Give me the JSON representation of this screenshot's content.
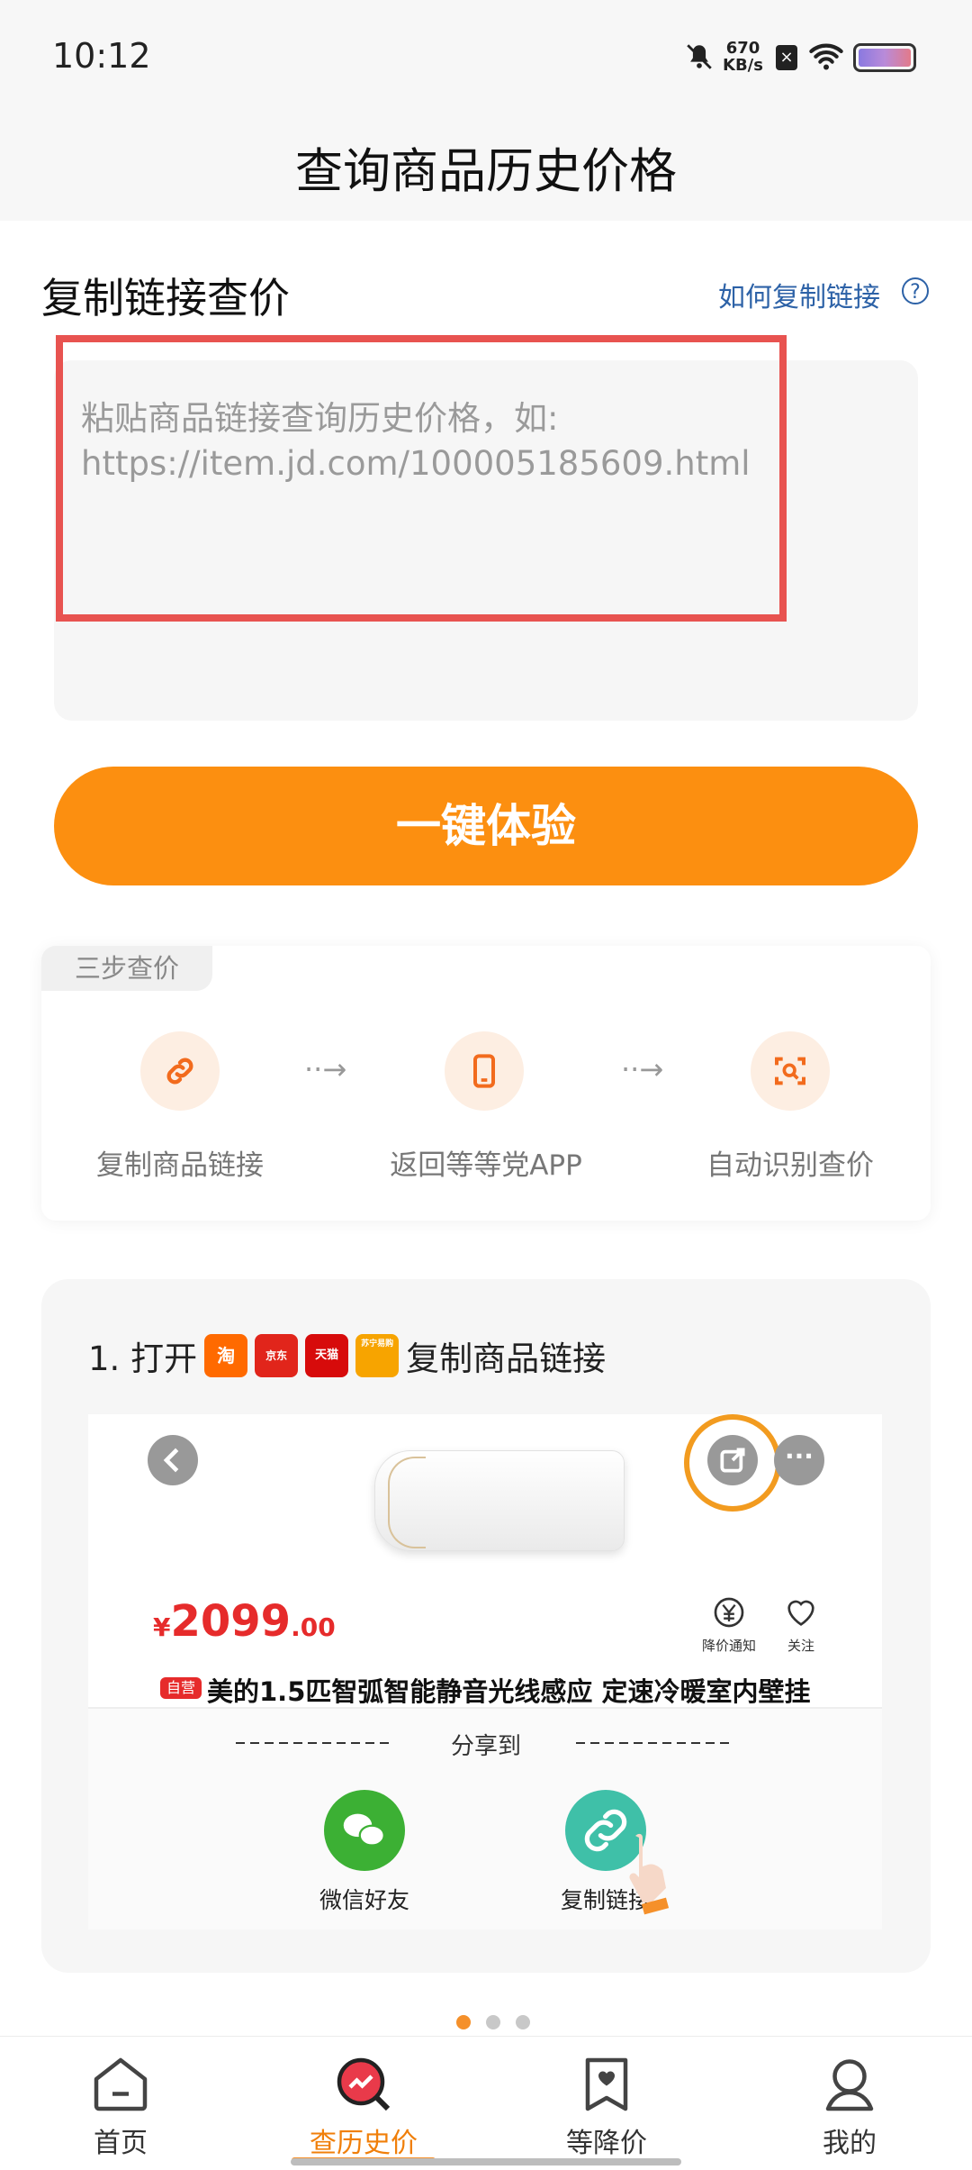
{
  "status_bar": {
    "time": "10:12",
    "net_speed_value": "670",
    "net_speed_unit": "KB/s"
  },
  "header": {
    "title": "查询商品历史价格"
  },
  "copy_section": {
    "title": "复制链接查价",
    "help_link": "如何复制链接",
    "help_icon": "?",
    "input_placeholder": "粘贴商品链接查询历史价格，如:\nhttps://item.jd.com/100005185609.html"
  },
  "primary_button": {
    "label": "一键体验"
  },
  "steps": {
    "tag": "三步查价",
    "items": [
      {
        "label": "复制商品链接",
        "icon": "link-icon"
      },
      {
        "label": "返回等等党APP",
        "icon": "phone-icon"
      },
      {
        "label": "自动识别查价",
        "icon": "scan-icon"
      }
    ],
    "arrow": "··→"
  },
  "tutorial": {
    "step_prefix": "1. 打开",
    "step_suffix": "复制商品链接",
    "app_logos": [
      {
        "name": "淘",
        "color": "#ff6a00"
      },
      {
        "name": "京东",
        "color": "#e1251b"
      },
      {
        "name": "天猫",
        "color": "#d70b0b"
      },
      {
        "name": "苏宁易购",
        "color": "#f7a400"
      }
    ],
    "preview": {
      "price_symbol": "¥",
      "price_main": "2099",
      "price_decimal": ".00",
      "badge": "自营",
      "product_name": "美的1.5匹智弧智能静音光线感应 定速冷暖室内壁挂",
      "price_alert_label": "降价通知",
      "follow_label": "关注",
      "share_to": "分享到",
      "share_options": [
        {
          "label": "微信好友",
          "color": "#3cb034"
        },
        {
          "label": "复制链接",
          "color": "#3fc0a8"
        }
      ]
    },
    "pager": {
      "total": 3,
      "active": 0
    }
  },
  "bottom_nav": {
    "items": [
      {
        "label": "首页",
        "active": false
      },
      {
        "label": "查历史价",
        "active": true
      },
      {
        "label": "等降价",
        "active": false
      },
      {
        "label": "我的",
        "active": false
      }
    ],
    "active_color": "#f07f0a"
  },
  "colors": {
    "accent": "#fc8f10",
    "link": "#2d62a7",
    "highlight_border": "#e85350",
    "price_red": "#e62b2b"
  }
}
